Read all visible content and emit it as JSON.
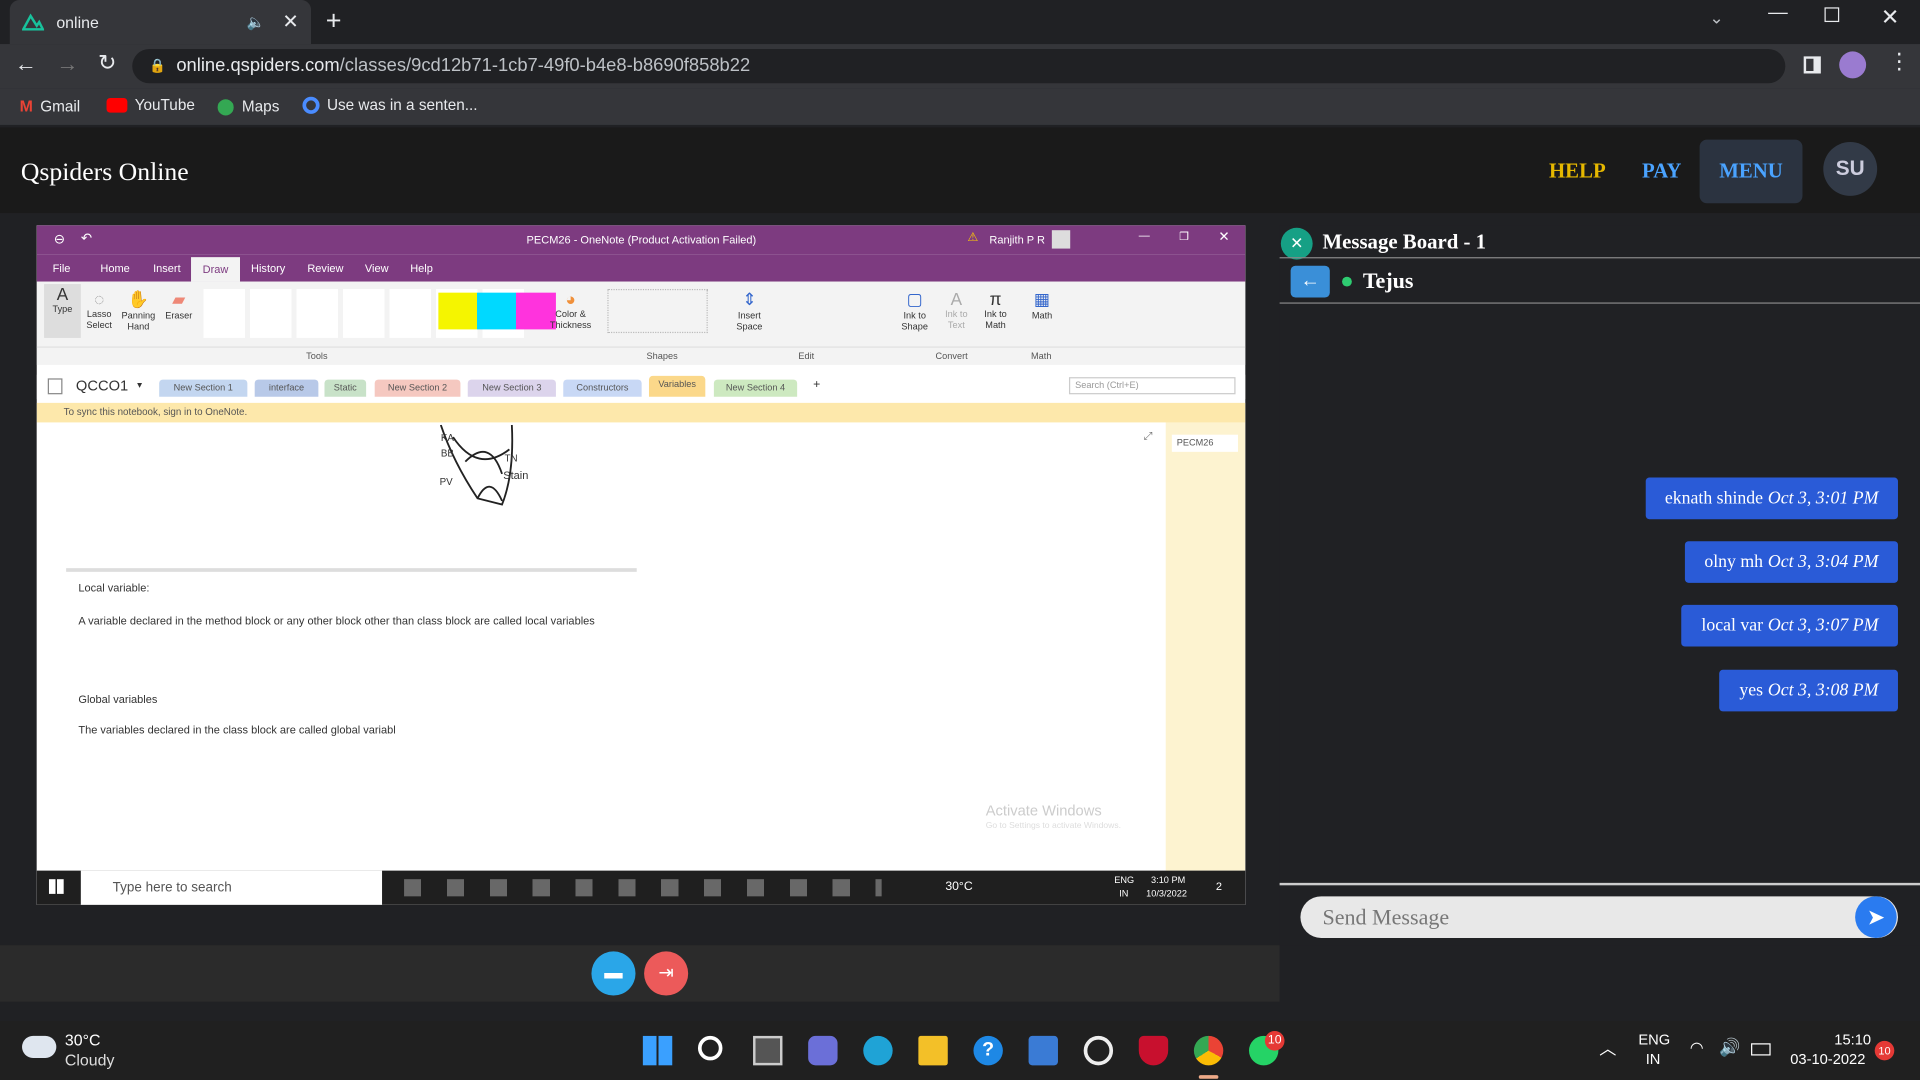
{
  "browser": {
    "tab_title": "online",
    "url_domain": "online.qspiders.com",
    "url_path": "/classes/9cd12b71-1cb7-49f0-b4e8-b8690f858b22",
    "bookmarks": [
      "Gmail",
      "YouTube",
      "Maps",
      "Use was in a senten..."
    ]
  },
  "site": {
    "logo": "Qspiders Online",
    "nav": {
      "help": "HELP",
      "pay": "PAY",
      "menu": "MENU",
      "avatar": "SU"
    }
  },
  "onenote": {
    "window_title": "PECM26 - OneNote (Product Activation Failed)",
    "user": "Ranjith P R",
    "menu_tabs": [
      "File",
      "Home",
      "Insert",
      "Draw",
      "History",
      "Review",
      "View",
      "Help"
    ],
    "active_tab": "Draw",
    "ribbon_tools": [
      "Type",
      "Lasso Select",
      "Panning Hand",
      "Eraser"
    ],
    "ribbon_groups": [
      "Tools",
      "Shapes",
      "Edit",
      "Convert",
      "Math"
    ],
    "ribbon_other": [
      "Color & Thickness",
      "Insert Space",
      "Ink to Shape",
      "Ink to Text",
      "Ink to Math",
      "Math"
    ],
    "notebook": "QCCO1",
    "sections": [
      "New Section 1",
      "interface",
      "Static",
      "New Section 2",
      "New Section 3",
      "Constructors",
      "Variables",
      "New Section 4"
    ],
    "active_section": "Variables",
    "search_placeholder": "Search (Ctrl+E)",
    "sync_message": "To sync this notebook, sign in to OneNote.",
    "page_name": "PECM26",
    "diagram_labels": [
      "KA",
      "BB",
      "PV",
      "TN",
      "Stain"
    ],
    "notes": {
      "h1": "Local variable:",
      "p1": "A variable declared in the method block or any other block other than class block are called local variables",
      "h2": "Global variables",
      "p2": "The variables declared in the class block are called global variabl"
    },
    "watermark_title": "Activate Windows",
    "watermark_sub": "Go to Settings to activate Windows.",
    "taskbar": {
      "search": "Type here to search",
      "weather": "30°C",
      "lang": "ENG",
      "region": "IN",
      "time": "3:10 PM",
      "date": "10/3/2022",
      "notif": "2"
    }
  },
  "message_board": {
    "title": "Message Board - 1",
    "contact": "Tejus",
    "messages": [
      {
        "text": "eknath shinde",
        "time": "Oct 3, 3:01 PM"
      },
      {
        "text": "olny mh",
        "time": "Oct 3, 3:04 PM"
      },
      {
        "text": "local var",
        "time": "Oct 3, 3:07 PM"
      },
      {
        "text": "yes",
        "time": "Oct 3, 3:08 PM"
      }
    ],
    "input_placeholder": "Send Message"
  },
  "taskbar": {
    "temp": "30°C",
    "condition": "Cloudy",
    "lang": "ENG",
    "region": "IN",
    "time": "15:10",
    "date": "03-10-2022",
    "whatsapp_badge": "10",
    "notif_badge": "10"
  },
  "colors": {
    "accent": "#2a5bd7",
    "onenote": "#7d3b80",
    "help": "#e6b800",
    "menu": "#4aa3ff"
  }
}
